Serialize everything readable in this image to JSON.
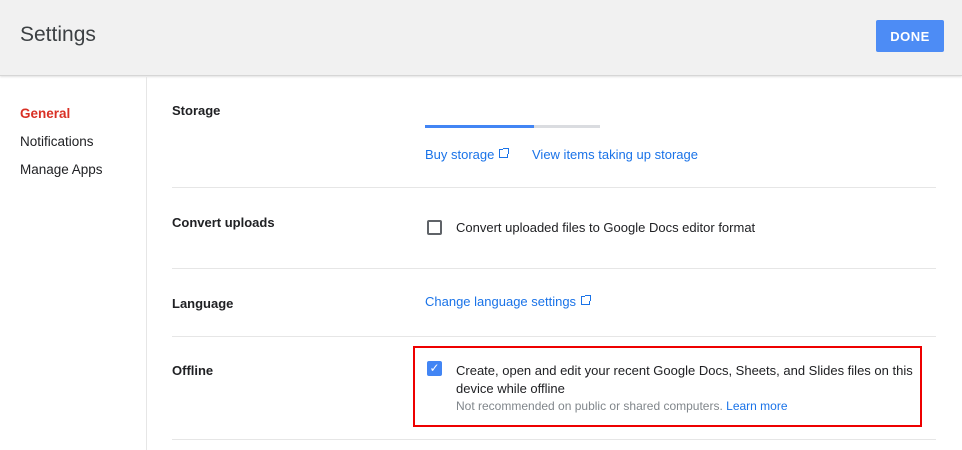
{
  "header": {
    "title": "Settings",
    "done_label": "DONE"
  },
  "sidebar": {
    "items": [
      {
        "label": "General",
        "active": true
      },
      {
        "label": "Notifications"
      },
      {
        "label": "Manage Apps"
      }
    ]
  },
  "storage": {
    "label": "Storage",
    "used_fraction": 0.62,
    "buy_label": "Buy storage",
    "view_label": "View items taking up storage"
  },
  "convert": {
    "label": "Convert uploads",
    "checkbox_label": "Convert uploaded files to Google Docs editor format",
    "checked": false
  },
  "language": {
    "label": "Language",
    "link": "Change language settings"
  },
  "offline": {
    "label": "Offline",
    "checkbox_label": "Create, open and edit your recent Google Docs, Sheets, and Slides files on this device while offline",
    "checked": true,
    "note": "Not recommended on public or shared computers.",
    "learn_more": "Learn more"
  },
  "colors": {
    "accent": "#4285f4",
    "active_nav": "#d93025",
    "highlight": "#ee0000"
  }
}
